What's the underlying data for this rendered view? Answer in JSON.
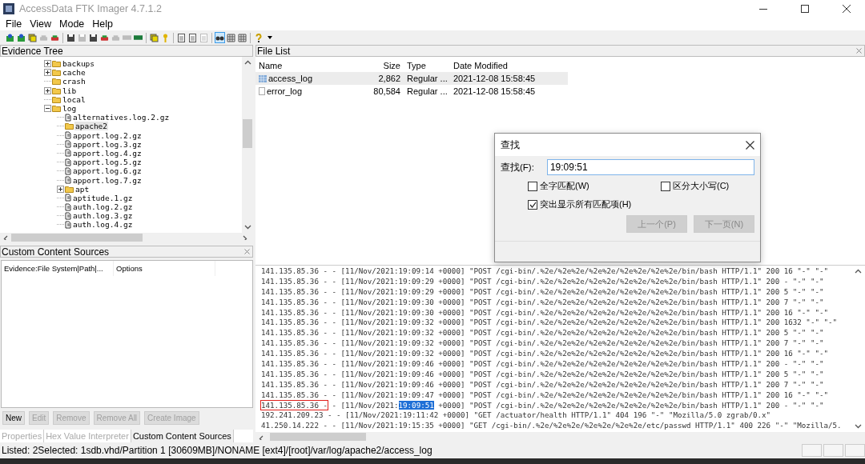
{
  "window": {
    "title": "AccessData FTK Imager 4.7.1.2"
  },
  "menu": [
    "File",
    "View",
    "Mode",
    "Help"
  ],
  "toolbar": [
    {
      "kind": "puzzle",
      "disabled": false,
      "pressed": false
    },
    {
      "kind": "puzzle",
      "disabled": false,
      "pressed": false
    },
    {
      "kind": "stack",
      "disabled": false,
      "pressed": false
    },
    {
      "kind": "drive",
      "disabled": true,
      "pressed": false
    },
    {
      "kind": "drive",
      "disabled": false,
      "pressed": false
    },
    {
      "kind": "separator"
    },
    {
      "kind": "floppy",
      "disabled": false,
      "pressed": false
    },
    {
      "kind": "floppy",
      "disabled": true,
      "pressed": false
    },
    {
      "kind": "floppy",
      "disabled": false,
      "pressed": false
    },
    {
      "kind": "drive",
      "disabled": false,
      "pressed": false
    },
    {
      "kind": "drive",
      "disabled": true,
      "pressed": false
    },
    {
      "kind": "bar",
      "disabled": true,
      "pressed": false
    },
    {
      "kind": "bar",
      "disabled": false,
      "pressed": false
    },
    {
      "kind": "separator"
    },
    {
      "kind": "stack",
      "disabled": false,
      "pressed": false
    },
    {
      "kind": "key",
      "disabled": false,
      "pressed": false
    },
    {
      "kind": "separator"
    },
    {
      "kind": "page",
      "disabled": false,
      "pressed": false
    },
    {
      "kind": "page",
      "disabled": false,
      "pressed": false
    },
    {
      "kind": "page",
      "disabled": true,
      "pressed": false
    },
    {
      "kind": "separator"
    },
    {
      "kind": "binoculars",
      "disabled": false,
      "pressed": true
    },
    {
      "kind": "grid",
      "disabled": false,
      "pressed": false
    },
    {
      "kind": "grid",
      "disabled": false,
      "pressed": false
    },
    {
      "kind": "separator"
    },
    {
      "kind": "help",
      "disabled": false,
      "pressed": false
    },
    {
      "kind": "caret",
      "pressed": false
    }
  ],
  "evidence_tree": {
    "title": "Evidence Tree",
    "items": [
      {
        "label": "backups",
        "kind": "folder",
        "expanded": false,
        "selected": false
      },
      {
        "label": "cache",
        "kind": "folder",
        "expanded": false,
        "selected": false
      },
      {
        "label": "crash",
        "kind": "folder",
        "selected": false
      },
      {
        "label": "lib",
        "kind": "folder",
        "expanded": false,
        "selected": false
      },
      {
        "label": "local",
        "kind": "folder",
        "selected": false
      },
      {
        "label": "log",
        "kind": "folder",
        "expanded": true,
        "selected": false,
        "children": [
          {
            "label": "alternatives.log.2.gz",
            "kind": "file",
            "selected": false
          },
          {
            "label": "apache2",
            "kind": "folder",
            "selected": true
          },
          {
            "label": "apport.log.2.gz",
            "kind": "file",
            "selected": false
          },
          {
            "label": "apport.log.3.gz",
            "kind": "file",
            "selected": false
          },
          {
            "label": "apport.log.4.gz",
            "kind": "file",
            "selected": false
          },
          {
            "label": "apport.log.5.gz",
            "kind": "file",
            "selected": false
          },
          {
            "label": "apport.log.6.gz",
            "kind": "file",
            "selected": false
          },
          {
            "label": "apport.log.7.gz",
            "kind": "file",
            "selected": false
          },
          {
            "label": "apt",
            "kind": "folder",
            "expanded": false,
            "selected": false
          },
          {
            "label": "aptitude.1.gz",
            "kind": "file",
            "selected": false
          },
          {
            "label": "auth.log.2.gz",
            "kind": "file",
            "selected": false
          },
          {
            "label": "auth.log.3.gz",
            "kind": "file",
            "selected": false
          },
          {
            "label": "auth.log.4.gz",
            "kind": "file",
            "selected": false
          }
        ]
      }
    ]
  },
  "custom_content_sources": {
    "title": "Custom Content Sources",
    "columns": [
      "Evidence:File System|Path|...",
      "Options"
    ],
    "buttons": [
      {
        "label": "New",
        "disabled": false
      },
      {
        "label": "Edit",
        "disabled": true
      },
      {
        "label": "Remove",
        "disabled": true
      },
      {
        "label": "Remove All",
        "disabled": true
      },
      {
        "label": "Create Image",
        "disabled": true
      }
    ]
  },
  "bottom_tabs": [
    {
      "label": "Properties",
      "selected": false
    },
    {
      "label": "Hex Value Interpreter",
      "selected": false
    },
    {
      "label": "Custom Content Sources",
      "selected": true
    }
  ],
  "file_list": {
    "title": "File List",
    "columns": [
      "Name",
      "Size",
      "Type",
      "Date Modified"
    ],
    "rows": [
      {
        "kind": "table",
        "name": "access_log",
        "size": "2,862",
        "type": "Regular ...",
        "date": "2021-12-08 15:58:45",
        "selected": true
      },
      {
        "kind": "file",
        "name": "error_log",
        "size": "80,584",
        "type": "Regular ...",
        "date": "2021-12-08 15:58:45",
        "selected": false
      }
    ]
  },
  "log_view": {
    "lines": [
      {
        "parts": [
          {
            "kind": "plain",
            "text": "141.135.85.36 - - [11/Nov/2021:19:09:14 +0000] \"POST /cgi-bin/.%2e/%2e%2e/%2e%2e/%2e%2e/%2e%2e/bin/bash HTTP/1.1\" 200 16 \"-\" \"-\""
          }
        ]
      },
      {
        "parts": [
          {
            "kind": "plain",
            "text": "141.135.85.36 - - [11/Nov/2021:19:09:29 +0000] \"POST /cgi-bin/.%2e/%2e%2e/%2e%2e/%2e%2e/%2e%2e/bin/bash HTTP/1.1\" 200 - \"-\" \"-\""
          }
        ]
      },
      {
        "parts": [
          {
            "kind": "plain",
            "text": "141.135.85.36 - - [11/Nov/2021:19:09:29 +0000] \"POST /cgi-bin/.%2e/%2e%2e/%2e%2e/%2e%2e/%2e%2e/bin/bash HTTP/1.1\" 200 5 \"-\" \"-\""
          }
        ]
      },
      {
        "parts": [
          {
            "kind": "plain",
            "text": "141.135.85.36 - - [11/Nov/2021:19:09:30 +0000] \"POST /cgi-bin/.%2e/%2e%2e/%2e%2e/%2e%2e/%2e%2e/bin/bash HTTP/1.1\" 200 7 \"-\" \"-\""
          }
        ]
      },
      {
        "parts": [
          {
            "kind": "plain",
            "text": "141.135.85.36 - - [11/Nov/2021:19:09:30 +0000] \"POST /cgi-bin/.%2e/%2e%2e/%2e%2e/%2e%2e/%2e%2e/bin/bash HTTP/1.1\" 200 16 \"-\" \"-\""
          }
        ]
      },
      {
        "parts": [
          {
            "kind": "plain",
            "text": "141.135.85.36 - - [11/Nov/2021:19:09:32 +0000] \"POST /cgi-bin/.%2e/%2e%2e/%2e%2e/%2e%2e/%2e%2e/bin/bash HTTP/1.1\" 200 1632 \"-\" \"-\""
          }
        ]
      },
      {
        "parts": [
          {
            "kind": "plain",
            "text": "141.135.85.36 - - [11/Nov/2021:19:09:32 +0000] \"POST /cgi-bin/.%2e/%2e%2e/%2e%2e/%2e%2e/%2e%2e/bin/bash HTTP/1.1\" 200 5 \"-\" \"-\""
          }
        ]
      },
      {
        "parts": [
          {
            "kind": "plain",
            "text": "141.135.85.36 - - [11/Nov/2021:19:09:32 +0000] \"POST /cgi-bin/.%2e/%2e%2e/%2e%2e/%2e%2e/%2e%2e/bin/bash HTTP/1.1\" 200 7 \"-\" \"-\""
          }
        ]
      },
      {
        "parts": [
          {
            "kind": "plain",
            "text": "141.135.85.36 - - [11/Nov/2021:19:09:32 +0000] \"POST /cgi-bin/.%2e/%2e%2e/%2e%2e/%2e%2e/%2e%2e/bin/bash HTTP/1.1\" 200 16 \"-\" \"-\""
          }
        ]
      },
      {
        "parts": [
          {
            "kind": "plain",
            "text": "141.135.85.36 - - [11/Nov/2021:19:09:46 +0000] \"POST /cgi-bin/.%2e/%2e%2e/%2e%2e/%2e%2e/%2e%2e/bin/bash HTTP/1.1\" 200 - \"-\" \"-\""
          }
        ]
      },
      {
        "parts": [
          {
            "kind": "plain",
            "text": "141.135.85.36 - - [11/Nov/2021:19:09:46 +0000] \"POST /cgi-bin/.%2e/%2e%2e/%2e%2e/%2e%2e/%2e%2e/bin/bash HTTP/1.1\" 200 5 \"-\" \"-\""
          }
        ]
      },
      {
        "parts": [
          {
            "kind": "plain",
            "text": "141.135.85.36 - - [11/Nov/2021:19:09:46 +0000] \"POST /cgi-bin/.%2e/%2e%2e/%2e%2e/%2e%2e/%2e%2e/bin/bash HTTP/1.1\" 200 7 \"-\" \"-\""
          }
        ]
      },
      {
        "parts": [
          {
            "kind": "plain",
            "text": "141.135.85.36 - - [11/Nov/2021:19:09:47 +0000] \"POST /cgi-bin/.%2e/%2e%2e/%2e%2e/%2e%2e/%2e%2e/bin/bash HTTP/1.1\" 200 16 \"-\" \"-\""
          }
        ]
      },
      {
        "parts": [
          {
            "kind": "boxed",
            "text": "141.135.85.36 -"
          },
          {
            "kind": "plain",
            "text": " - [11/Nov/2021:"
          },
          {
            "kind": "hit",
            "text": "19:09:51"
          },
          {
            "kind": "plain",
            "text": " +0000] \"POST /cgi-bin/.%2e/%2e%2e/%2e%2e/%2e%2e/%2e%2e/bin/bash HTTP/1.1\" 200 - \"-\" \"-\""
          }
        ]
      },
      {
        "parts": [
          {
            "kind": "plain",
            "text": "192.241.209.23 - - [11/Nov/2021:19:11:42 +0000] \"GET /actuator/health HTTP/1.1\" 404 196 \"-\" \"Mozilla/5.0 zgrab/0.x\""
          }
        ]
      },
      {
        "parts": [
          {
            "kind": "plain",
            "text": "41.250.14.222 - - [11/Nov/2021:19:15:35 +0000] \"GET /cgi-bin/.%2e/%2e%2e/%2e%2e/%2e%2e/etc/passwd HTTP/1.1\" 400 226 \"-\" \"Mozilla/5."
          }
        ]
      }
    ]
  },
  "find_dialog": {
    "title": "查找",
    "label": "查找(F):",
    "value": "19:09:51",
    "options": [
      {
        "label": "全字匹配(W)",
        "checked": false
      },
      {
        "label": "区分大小写(C)",
        "checked": false
      },
      {
        "label": "突出显示所有匹配项(H)",
        "checked": true
      }
    ],
    "buttons": [
      {
        "label": "上一个(P)",
        "disabled": true
      },
      {
        "label": "下一页(N)",
        "disabled": true
      }
    ]
  },
  "status_bar": {
    "text": "Listed: 2Selected: 1sdb.vhd/Partition 1 [30609MB]/NONAME [ext4]/[root]/var/log/apache2/access_log"
  }
}
